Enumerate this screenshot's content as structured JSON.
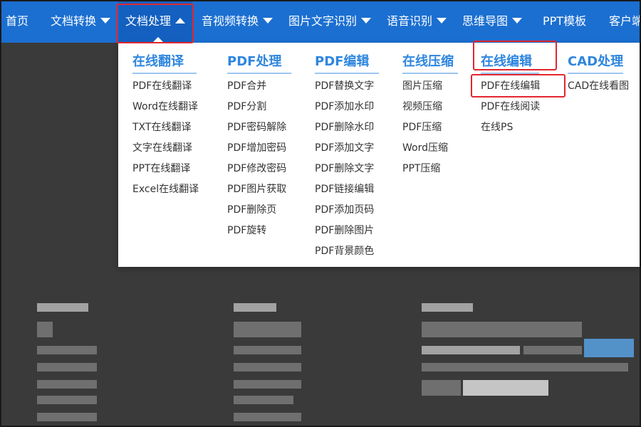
{
  "nav": {
    "items": [
      {
        "label": "首页",
        "dropdown": false
      },
      {
        "label": "文档转换",
        "dropdown": true
      },
      {
        "label": "文档处理",
        "dropdown": true,
        "active": true
      },
      {
        "label": "音视频转换",
        "dropdown": true
      },
      {
        "label": "图片文字识别",
        "dropdown": true
      },
      {
        "label": "语音识别",
        "dropdown": true
      },
      {
        "label": "思维导图",
        "dropdown": true
      },
      {
        "label": "PPT模板",
        "dropdown": false
      },
      {
        "label": "客户端",
        "dropdown": false
      }
    ]
  },
  "menu": {
    "columns": [
      {
        "title": "在线翻译",
        "items": [
          "PDF在线翻译",
          "Word在线翻译",
          "TXT在线翻译",
          "文字在线翻译",
          "PPT在线翻译",
          "Excel在线翻译"
        ]
      },
      {
        "title": "PDF处理",
        "items": [
          "PDF合并",
          "PDF分割",
          "PDF密码解除",
          "PDF增加密码",
          "PDF修改密码",
          "PDF图片获取",
          "PDF删除页",
          "PDF旋转"
        ]
      },
      {
        "title": "PDF编辑",
        "items": [
          "PDF替换文字",
          "PDF添加水印",
          "PDF删除水印",
          "PDF添加文字",
          "PDF删除文字",
          "PDF链接编辑",
          "PDF添加页码",
          "PDF删除图片",
          "PDF背景颜色"
        ]
      },
      {
        "title": "在线压缩",
        "items": [
          "图片压缩",
          "视频压缩",
          "PDF压缩",
          "Word压缩",
          "PPT压缩"
        ]
      },
      {
        "title": "在线编辑",
        "items": [
          "PDF在线编辑",
          "PDF在线阅读",
          "在线PS"
        ]
      },
      {
        "title": "CAD处理",
        "items": [
          "CAD在线看图"
        ]
      }
    ]
  },
  "colors": {
    "nav_bg": "#1b6fd1",
    "heading": "#2e86de",
    "highlight": "#e3262e"
  }
}
